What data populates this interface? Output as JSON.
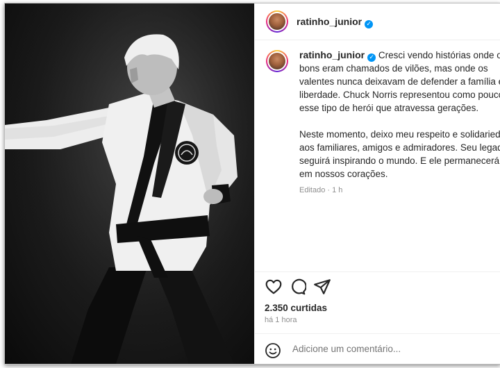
{
  "post": {
    "username": "ratinho_junior",
    "verified_mark": "✓",
    "caption_paragraphs": [
      "Cresci vendo histórias onde os bons eram chamados de vilões, mas onde os valentes nunca deixavam de defender a família e a liberdade. Chuck Norris representou como poucos esse tipo de herói que atravessa gerações.",
      "Neste momento, deixo meu respeito e solidariedade aos familiares, amigos e admiradores. Seu legado seguirá inspirando o mundo. E ele permanecerá vivo em nossos corações."
    ],
    "edited_label": "Editado · 1 h",
    "likes": "2.350 curtidas",
    "time_ago": "há 1 hora",
    "comment_placeholder": "Adicione um comentário...",
    "icons": {
      "like": "heart-icon",
      "comment": "comment-bubble-icon",
      "share": "paper-plane-icon",
      "emoji": "emoji-smiley-icon"
    },
    "colors": {
      "verified": "#0095f6",
      "text": "#262626",
      "secondary": "#8e8e8e"
    }
  }
}
